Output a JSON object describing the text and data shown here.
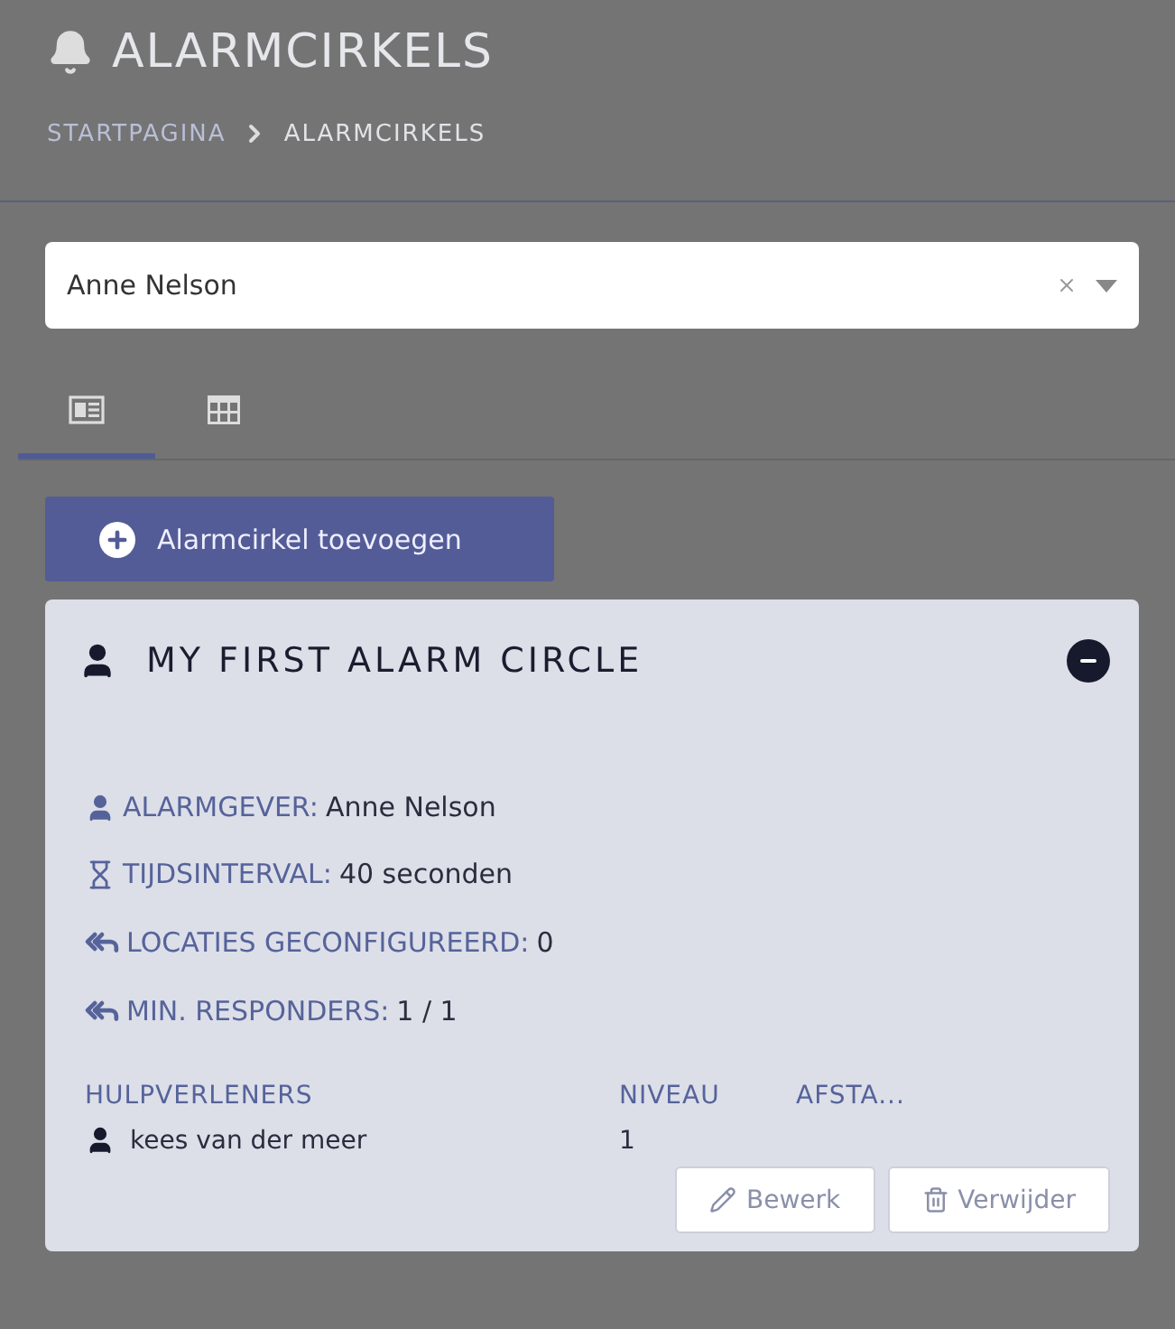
{
  "header": {
    "title": "ALARMCIRKELS"
  },
  "breadcrumb": [
    {
      "label": "STARTPAGINA",
      "kind": "link"
    },
    {
      "label": "ALARMCIRKELS",
      "kind": "current"
    }
  ],
  "select": {
    "value": "Anne Nelson"
  },
  "tabs": [
    {
      "kind": "cards",
      "selected": true
    },
    {
      "kind": "table",
      "selected": false
    }
  ],
  "add_button": {
    "label": "Alarmcirkel toevoegen"
  },
  "card": {
    "title": "MY FIRST ALARM CIRCLE",
    "expanded": true,
    "info": [
      {
        "kind": "person",
        "label": "ALARMGEVER:",
        "value": "Anne Nelson"
      },
      {
        "kind": "hourglass",
        "label": "TIJDSINTERVAL:",
        "value": "40 seconden"
      },
      {
        "kind": "reply",
        "label": "LOCATIES GECONFIGUREERD:",
        "value": "0"
      },
      {
        "kind": "reply",
        "label": "MIN. RESPONDERS:",
        "value": "1 / 1"
      }
    ],
    "columns": [
      "HULPVERLENERS",
      "NIVEAU",
      "AFSTA..."
    ],
    "rows": [
      {
        "name": "kees van der meer",
        "level_text": "1"
      }
    ],
    "actions": [
      {
        "kind": "edit",
        "label": "Bewerk"
      },
      {
        "kind": "delete",
        "label": "Verwijder"
      }
    ]
  }
}
